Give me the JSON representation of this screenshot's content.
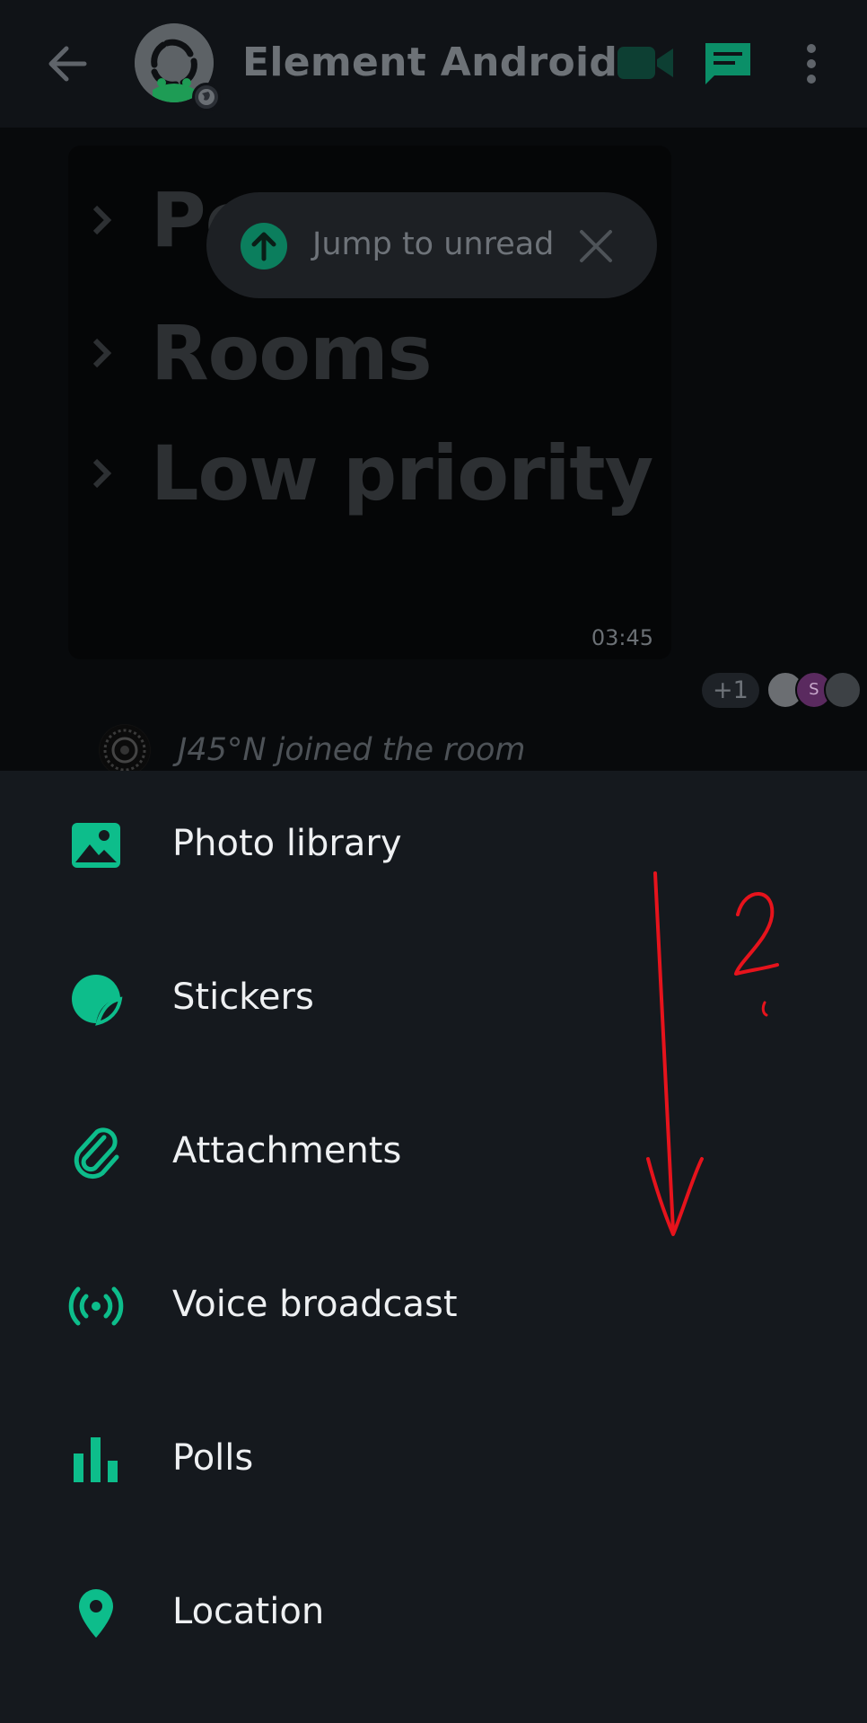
{
  "colors": {
    "accent": "#0dbd8b",
    "background": "#15191e",
    "annotation": "#e6131c"
  },
  "header": {
    "title": "Element Android",
    "back_icon": "arrow-left-icon",
    "video_icon": "video-camera-icon",
    "threads_icon": "threads-icon",
    "more_icon": "more-vertical-icon"
  },
  "timeline": {
    "image_message": {
      "rows": [
        "Pe",
        "Rooms",
        "Low priority"
      ],
      "time": "03:45"
    },
    "jump_to_unread": {
      "label": "Jump to unread"
    },
    "read_receipts": {
      "extra_count": "+1",
      "avatars": [
        "",
        "S",
        ""
      ]
    },
    "membership_event": "J45°N joined the room"
  },
  "attachment_sheet": {
    "items": [
      {
        "label": "Photo library",
        "icon": "image-icon"
      },
      {
        "label": "Stickers",
        "icon": "sticker-icon"
      },
      {
        "label": "Attachments",
        "icon": "paperclip-icon"
      },
      {
        "label": "Voice broadcast",
        "icon": "broadcast-icon"
      },
      {
        "label": "Polls",
        "icon": "poll-icon"
      },
      {
        "label": "Location",
        "icon": "location-pin-icon"
      }
    ]
  },
  "annotation": {
    "text": "2."
  }
}
